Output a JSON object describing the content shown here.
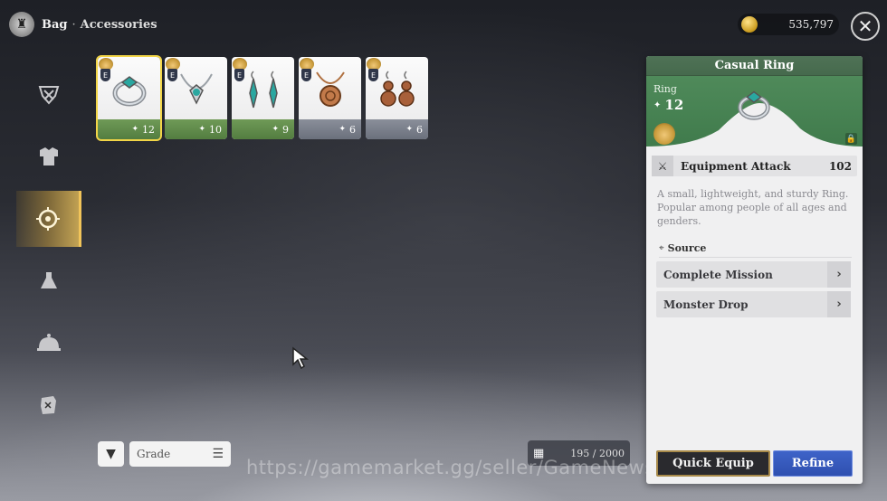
{
  "header": {
    "title": "Bag",
    "separator": "·",
    "subtitle": "Accessories"
  },
  "currency": {
    "amount": "535,797",
    "icon": "gold-coin-icon"
  },
  "sidebar": {
    "items": [
      {
        "icon": "weapon-crest-icon",
        "active": false
      },
      {
        "icon": "armor-icon",
        "active": false
      },
      {
        "icon": "accessory-icon",
        "active": true
      },
      {
        "icon": "potion-icon",
        "active": false
      },
      {
        "icon": "food-cloche-icon",
        "active": false
      },
      {
        "icon": "map-scroll-icon",
        "active": false
      }
    ]
  },
  "items": [
    {
      "name": "ring",
      "grade": "E",
      "count": "12",
      "rarity": "green",
      "selected": true
    },
    {
      "name": "necklace",
      "grade": "E",
      "count": "10",
      "rarity": "green",
      "selected": false
    },
    {
      "name": "earrings-teal",
      "grade": "E",
      "count": "9",
      "rarity": "green",
      "selected": false
    },
    {
      "name": "pendant-copper",
      "grade": "E",
      "count": "6",
      "rarity": "gray",
      "selected": false
    },
    {
      "name": "earrings-copper",
      "grade": "E",
      "count": "6",
      "rarity": "gray",
      "selected": false
    }
  ],
  "controls": {
    "grade_label": "Grade",
    "capacity": "195 / 2000"
  },
  "watermark": "https://gamemarket.gg/seller/GameNews",
  "detail": {
    "name": "Casual Ring",
    "type": "Ring",
    "quantity": "12",
    "stat_label": "Equipment Attack",
    "stat_value": "102",
    "description": "A small, lightweight, and sturdy Ring. Popular among people of all ages and genders.",
    "source_header": "Source",
    "sources": [
      "Complete Mission",
      "Monster Drop"
    ],
    "quick_equip": "Quick Equip",
    "refine": "Refine"
  },
  "colors": {
    "accent_gold": "#f1c45a",
    "panel_green": "#4f8a5a",
    "refine_blue": "#3e63c8"
  }
}
